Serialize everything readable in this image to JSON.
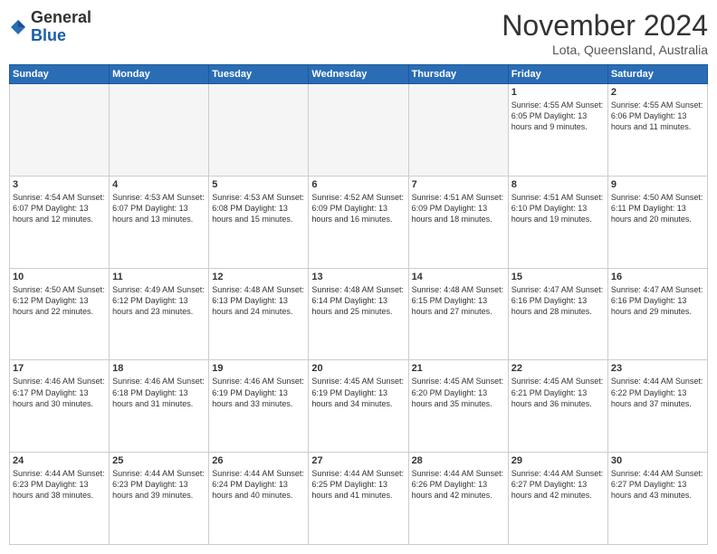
{
  "header": {
    "logo_general": "General",
    "logo_blue": "Blue",
    "month_title": "November 2024",
    "location": "Lota, Queensland, Australia"
  },
  "calendar": {
    "days_of_week": [
      "Sunday",
      "Monday",
      "Tuesday",
      "Wednesday",
      "Thursday",
      "Friday",
      "Saturday"
    ],
    "weeks": [
      [
        {
          "day": "",
          "info": ""
        },
        {
          "day": "",
          "info": ""
        },
        {
          "day": "",
          "info": ""
        },
        {
          "day": "",
          "info": ""
        },
        {
          "day": "",
          "info": ""
        },
        {
          "day": "1",
          "info": "Sunrise: 4:55 AM\nSunset: 6:05 PM\nDaylight: 13 hours\nand 9 minutes."
        },
        {
          "day": "2",
          "info": "Sunrise: 4:55 AM\nSunset: 6:06 PM\nDaylight: 13 hours\nand 11 minutes."
        }
      ],
      [
        {
          "day": "3",
          "info": "Sunrise: 4:54 AM\nSunset: 6:07 PM\nDaylight: 13 hours\nand 12 minutes."
        },
        {
          "day": "4",
          "info": "Sunrise: 4:53 AM\nSunset: 6:07 PM\nDaylight: 13 hours\nand 13 minutes."
        },
        {
          "day": "5",
          "info": "Sunrise: 4:53 AM\nSunset: 6:08 PM\nDaylight: 13 hours\nand 15 minutes."
        },
        {
          "day": "6",
          "info": "Sunrise: 4:52 AM\nSunset: 6:09 PM\nDaylight: 13 hours\nand 16 minutes."
        },
        {
          "day": "7",
          "info": "Sunrise: 4:51 AM\nSunset: 6:09 PM\nDaylight: 13 hours\nand 18 minutes."
        },
        {
          "day": "8",
          "info": "Sunrise: 4:51 AM\nSunset: 6:10 PM\nDaylight: 13 hours\nand 19 minutes."
        },
        {
          "day": "9",
          "info": "Sunrise: 4:50 AM\nSunset: 6:11 PM\nDaylight: 13 hours\nand 20 minutes."
        }
      ],
      [
        {
          "day": "10",
          "info": "Sunrise: 4:50 AM\nSunset: 6:12 PM\nDaylight: 13 hours\nand 22 minutes."
        },
        {
          "day": "11",
          "info": "Sunrise: 4:49 AM\nSunset: 6:12 PM\nDaylight: 13 hours\nand 23 minutes."
        },
        {
          "day": "12",
          "info": "Sunrise: 4:48 AM\nSunset: 6:13 PM\nDaylight: 13 hours\nand 24 minutes."
        },
        {
          "day": "13",
          "info": "Sunrise: 4:48 AM\nSunset: 6:14 PM\nDaylight: 13 hours\nand 25 minutes."
        },
        {
          "day": "14",
          "info": "Sunrise: 4:48 AM\nSunset: 6:15 PM\nDaylight: 13 hours\nand 27 minutes."
        },
        {
          "day": "15",
          "info": "Sunrise: 4:47 AM\nSunset: 6:16 PM\nDaylight: 13 hours\nand 28 minutes."
        },
        {
          "day": "16",
          "info": "Sunrise: 4:47 AM\nSunset: 6:16 PM\nDaylight: 13 hours\nand 29 minutes."
        }
      ],
      [
        {
          "day": "17",
          "info": "Sunrise: 4:46 AM\nSunset: 6:17 PM\nDaylight: 13 hours\nand 30 minutes."
        },
        {
          "day": "18",
          "info": "Sunrise: 4:46 AM\nSunset: 6:18 PM\nDaylight: 13 hours\nand 31 minutes."
        },
        {
          "day": "19",
          "info": "Sunrise: 4:46 AM\nSunset: 6:19 PM\nDaylight: 13 hours\nand 33 minutes."
        },
        {
          "day": "20",
          "info": "Sunrise: 4:45 AM\nSunset: 6:19 PM\nDaylight: 13 hours\nand 34 minutes."
        },
        {
          "day": "21",
          "info": "Sunrise: 4:45 AM\nSunset: 6:20 PM\nDaylight: 13 hours\nand 35 minutes."
        },
        {
          "day": "22",
          "info": "Sunrise: 4:45 AM\nSunset: 6:21 PM\nDaylight: 13 hours\nand 36 minutes."
        },
        {
          "day": "23",
          "info": "Sunrise: 4:44 AM\nSunset: 6:22 PM\nDaylight: 13 hours\nand 37 minutes."
        }
      ],
      [
        {
          "day": "24",
          "info": "Sunrise: 4:44 AM\nSunset: 6:23 PM\nDaylight: 13 hours\nand 38 minutes."
        },
        {
          "day": "25",
          "info": "Sunrise: 4:44 AM\nSunset: 6:23 PM\nDaylight: 13 hours\nand 39 minutes."
        },
        {
          "day": "26",
          "info": "Sunrise: 4:44 AM\nSunset: 6:24 PM\nDaylight: 13 hours\nand 40 minutes."
        },
        {
          "day": "27",
          "info": "Sunrise: 4:44 AM\nSunset: 6:25 PM\nDaylight: 13 hours\nand 41 minutes."
        },
        {
          "day": "28",
          "info": "Sunrise: 4:44 AM\nSunset: 6:26 PM\nDaylight: 13 hours\nand 42 minutes."
        },
        {
          "day": "29",
          "info": "Sunrise: 4:44 AM\nSunset: 6:27 PM\nDaylight: 13 hours\nand 42 minutes."
        },
        {
          "day": "30",
          "info": "Sunrise: 4:44 AM\nSunset: 6:27 PM\nDaylight: 13 hours\nand 43 minutes."
        }
      ]
    ]
  }
}
